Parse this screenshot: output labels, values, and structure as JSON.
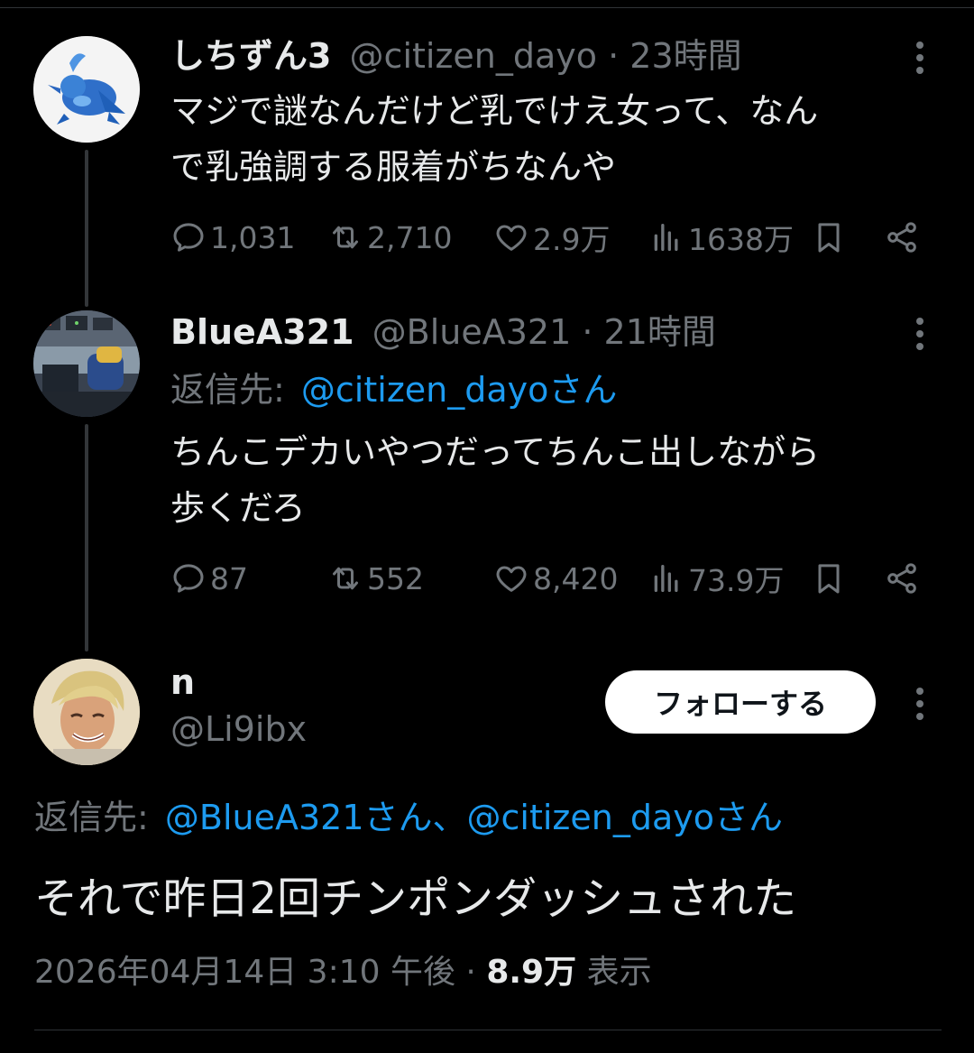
{
  "colors": {
    "background": "#000000",
    "text": "#e7e9ea",
    "muted": "#71767b",
    "link": "#1d9bf0",
    "follow_button": "#ffffff"
  },
  "tweets": [
    {
      "display_name": "しちずん3",
      "handle": "@citizen_dayo",
      "separator": "·",
      "time": "23時間",
      "text_lines": [
        "マジで謎なんだけど乳でけえ女って、なん",
        "で乳強調する服着がちなんや"
      ],
      "stats": {
        "replies": "1,031",
        "reposts": "2,710",
        "likes": "2.9万",
        "views": "1638万"
      },
      "avatar_icon": "blue-bird-avatar"
    },
    {
      "display_name": "BlueA321",
      "handle": "@BlueA321",
      "separator": "·",
      "time": "21時間",
      "reply_label": "返信先:",
      "reply_to": "@citizen_dayoさん",
      "text_lines": [
        "ちんこデカいやつだってちんこ出しながら",
        "歩くだろ"
      ],
      "stats": {
        "replies": "87",
        "reposts": "552",
        "likes": "8,420",
        "views": "73.9万"
      },
      "avatar_icon": "cockpit-photo-avatar"
    }
  ],
  "main_tweet": {
    "display_name": "n",
    "handle": "@Li9ibx",
    "follow_label": "フォローする",
    "reply_label": "返信先:",
    "reply_to": "@BlueA321さん、@citizen_dayoさん",
    "text": "それで昨日2回チンポンダッシュされた",
    "timestamp": "2026年04月14日 3:10 午後",
    "separator": "·",
    "view_count": "8.9万",
    "view_label": "表示",
    "avatar_icon": "anime-character-avatar"
  }
}
